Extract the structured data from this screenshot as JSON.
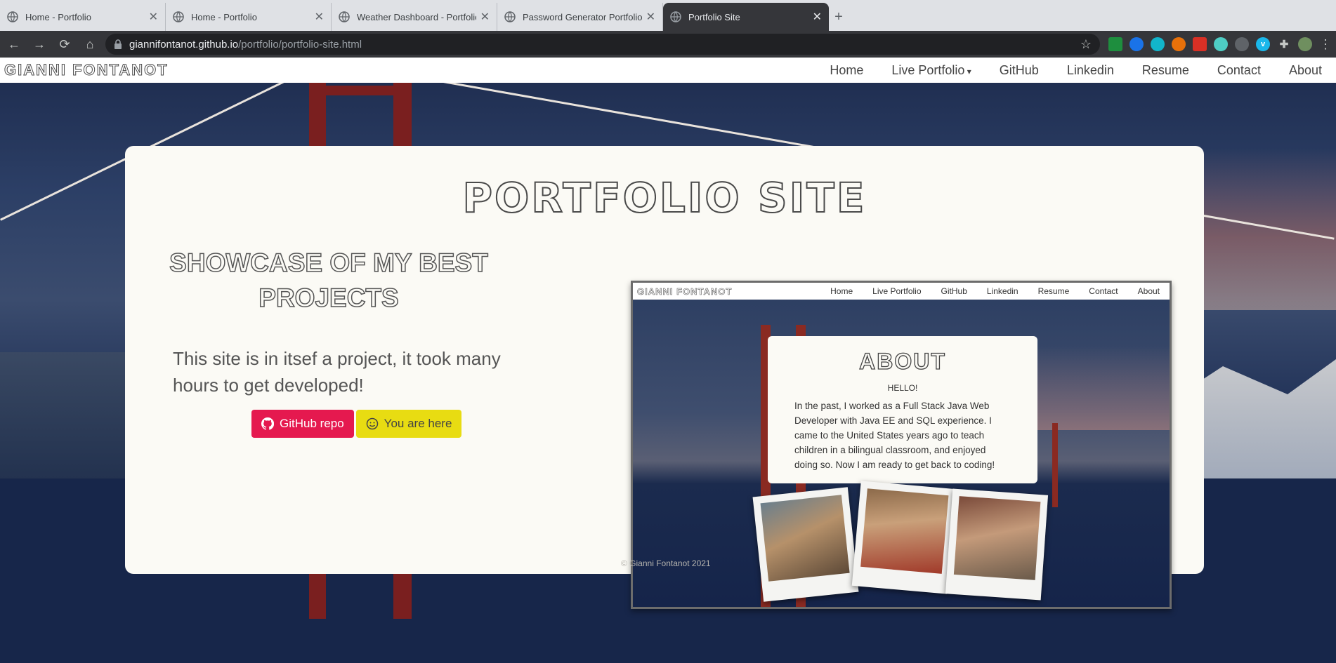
{
  "browser": {
    "tabs": [
      {
        "title": "Home - Portfolio",
        "active": false
      },
      {
        "title": "Home - Portfolio",
        "active": false
      },
      {
        "title": "Weather Dashboard - Portfolio",
        "active": false
      },
      {
        "title": "Password Generator Portfolio",
        "active": false
      },
      {
        "title": "Portfolio Site",
        "active": true
      }
    ],
    "url_host": "giannifontanot.github.io",
    "url_path": "/portfolio/portfolio-site.html"
  },
  "site": {
    "brand": "GIANNI FONTANOT",
    "nav": [
      "Home",
      "Live Portfolio",
      "GitHub",
      "Linkedin",
      "Resume",
      "Contact",
      "About"
    ]
  },
  "card": {
    "title": "PORTFOLIO SITE",
    "showcase": "SHOWCASE OF MY BEST PROJECTS",
    "description": "This site is in itsef a project, it took many hours to get developed!",
    "github_button": "GitHub repo",
    "here_button": "You are here",
    "footer": "© Gianni Fontanot 2021"
  },
  "preview": {
    "brand": "GIANNI FONTANOT",
    "nav": [
      "Home",
      "Live Portfolio",
      "GitHub",
      "Linkedin",
      "Resume",
      "Contact",
      "About"
    ],
    "about_title": "ABOUT",
    "hello": "HELLO!",
    "about_text": "In the past, I worked as a Full Stack Java Web Developer with Java EE and SQL experience. I came to the United States years ago to teach children in a bilingual classroom, and enjoyed doing so. Now I am ready to get back to coding!"
  },
  "colors": {
    "github_button": "#e5194f",
    "here_button": "#e8dc12",
    "card_bg": "#fbfaf5"
  }
}
